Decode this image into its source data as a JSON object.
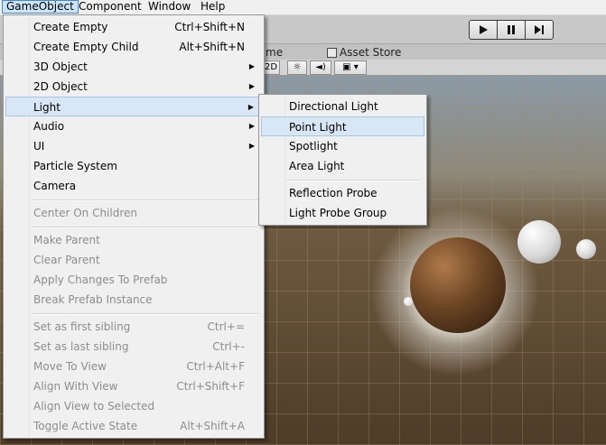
{
  "menubar": {
    "items": [
      {
        "label": "GameObject",
        "active": true
      },
      {
        "label": "Component"
      },
      {
        "label": "Window"
      },
      {
        "label": "Help"
      }
    ]
  },
  "tabs": {
    "game_partial": "me",
    "asset_store": "Asset Store"
  },
  "scenebar": {
    "mode_2d": "2D"
  },
  "gameobject_menu": {
    "items": [
      {
        "label": "Create Empty",
        "shortcut": "Ctrl+Shift+N"
      },
      {
        "label": "Create Empty Child",
        "shortcut": "Alt+Shift+N"
      },
      {
        "label": "3D Object",
        "submenu": true
      },
      {
        "label": "2D Object",
        "submenu": true
      },
      {
        "label": "Light",
        "submenu": true,
        "highlighted": true
      },
      {
        "label": "Audio",
        "submenu": true
      },
      {
        "label": "UI",
        "submenu": true
      },
      {
        "label": "Particle System"
      },
      {
        "label": "Camera"
      },
      {
        "label": "Center On Children",
        "disabled": true
      },
      {
        "label": "Make Parent",
        "disabled": true
      },
      {
        "label": "Clear Parent",
        "disabled": true
      },
      {
        "label": "Apply Changes To Prefab",
        "disabled": true
      },
      {
        "label": "Break Prefab Instance",
        "disabled": true
      },
      {
        "label": "Set as first sibling",
        "shortcut": "Ctrl+=",
        "disabled": true
      },
      {
        "label": "Set as last sibling",
        "shortcut": "Ctrl+-",
        "disabled": true
      },
      {
        "label": "Move To View",
        "shortcut": "Ctrl+Alt+F",
        "disabled": true
      },
      {
        "label": "Align With View",
        "shortcut": "Ctrl+Shift+F",
        "disabled": true
      },
      {
        "label": "Align View to Selected",
        "disabled": true
      },
      {
        "label": "Toggle Active State",
        "shortcut": "Alt+Shift+A",
        "disabled": true
      }
    ]
  },
  "light_submenu": {
    "items": [
      {
        "label": "Directional Light"
      },
      {
        "label": "Point Light",
        "highlighted": true
      },
      {
        "label": "Spotlight"
      },
      {
        "label": "Area Light"
      },
      {
        "label": "Reflection Probe"
      },
      {
        "label": "Light Probe Group"
      }
    ]
  },
  "colors": {
    "menu_bg": "#f0f0f0",
    "highlight": "#d9e6f5",
    "disabled_text": "#8d8d8d"
  }
}
